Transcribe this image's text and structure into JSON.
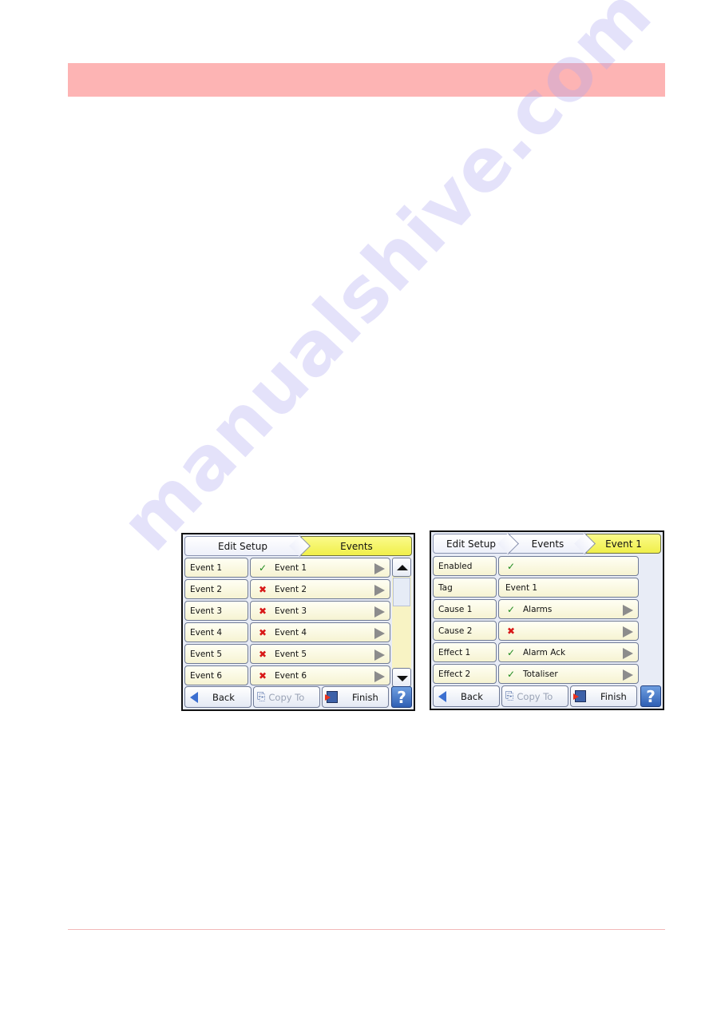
{
  "watermark": "manualshive.com",
  "screen_events": {
    "breadcrumb": [
      "Edit Setup",
      "Events"
    ],
    "rows": [
      {
        "label": "Event 1",
        "status": "enabled",
        "status_icon": "check-icon",
        "value": "Event 1"
      },
      {
        "label": "Event 2",
        "status": "disabled",
        "status_icon": "cross-icon",
        "value": "Event 2"
      },
      {
        "label": "Event 3",
        "status": "disabled",
        "status_icon": "cross-icon",
        "value": "Event 3"
      },
      {
        "label": "Event 4",
        "status": "disabled",
        "status_icon": "cross-icon",
        "value": "Event 4"
      },
      {
        "label": "Event 5",
        "status": "disabled",
        "status_icon": "cross-icon",
        "value": "Event 5"
      },
      {
        "label": "Event 6",
        "status": "disabled",
        "status_icon": "cross-icon",
        "value": "Event 6"
      }
    ],
    "footer": {
      "back": "Back",
      "copy_to": "Copy To",
      "finish": "Finish",
      "help": "?"
    }
  },
  "screen_event1": {
    "breadcrumb": [
      "Edit Setup",
      "Events",
      "Event 1"
    ],
    "rows": [
      {
        "label": "Enabled",
        "status_icon": "check-icon",
        "value": "",
        "has_arrow": false
      },
      {
        "label": "Tag",
        "status_icon": "",
        "value": "Event 1",
        "has_arrow": false
      },
      {
        "label": "Cause 1",
        "status_icon": "check-icon",
        "value": "Alarms",
        "has_arrow": true
      },
      {
        "label": "Cause 2",
        "status_icon": "cross-icon",
        "value": "",
        "has_arrow": true
      },
      {
        "label": "Effect 1",
        "status_icon": "check-icon",
        "value": "Alarm Ack",
        "has_arrow": true
      },
      {
        "label": "Effect 2",
        "status_icon": "check-icon",
        "value": "Totaliser",
        "has_arrow": true
      }
    ],
    "footer": {
      "back": "Back",
      "copy_to": "Copy To",
      "finish": "Finish",
      "help": "?"
    }
  },
  "icons": {
    "check": "✓",
    "cross": "✖",
    "copy": "⎘"
  },
  "colors": {
    "header_band": "#fdb4b4",
    "active_crumb": "#f0ef4a",
    "check": "#1e8a1e",
    "cross": "#d81818",
    "help": "#2f5fb4"
  }
}
